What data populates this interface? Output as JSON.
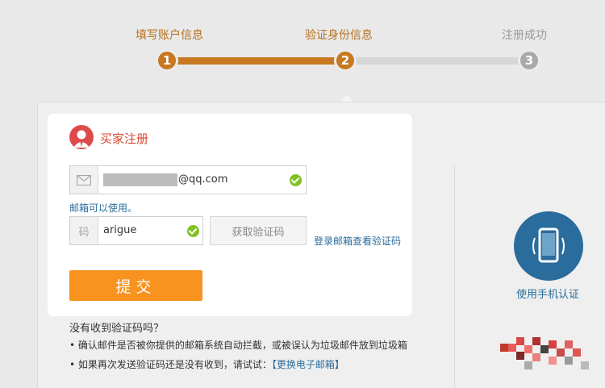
{
  "steps": [
    {
      "number": "1",
      "label": "填写账户信息"
    },
    {
      "number": "2",
      "label": "验证身份信息"
    },
    {
      "number": "3",
      "label": "注册成功"
    }
  ],
  "modal": {
    "title": "买家注册",
    "email": {
      "prefix_icon": "envelope-icon",
      "value_suffix": "@qq.com",
      "status_icon": "check-circle-icon"
    },
    "email_status": "邮箱可以使用。",
    "code": {
      "prefix": "码",
      "value": "arigue",
      "status_icon": "check-circle-icon"
    },
    "get_code_label": "获取验证码",
    "login_mail_link": "登录邮箱查看验证码",
    "submit_label": "提交"
  },
  "side": {
    "phone_label": "使用手机认证",
    "icon": "mobile-phone-icon"
  },
  "help": {
    "title": "没有收到验证码吗？",
    "line1": "• 确认邮件是否被你提供的邮箱系统自动拦截，或被误认为垃圾邮件放到垃圾箱",
    "line2_text": "• 如果再次发送验证码还是没有收到，请试试：",
    "line2_link": "【更换电子邮箱】"
  },
  "colors": {
    "accent": "#f7931e",
    "progress": "#c8781f",
    "link": "#2a6c9c",
    "title_red": "#d9472f",
    "ok_green": "#82c124"
  }
}
